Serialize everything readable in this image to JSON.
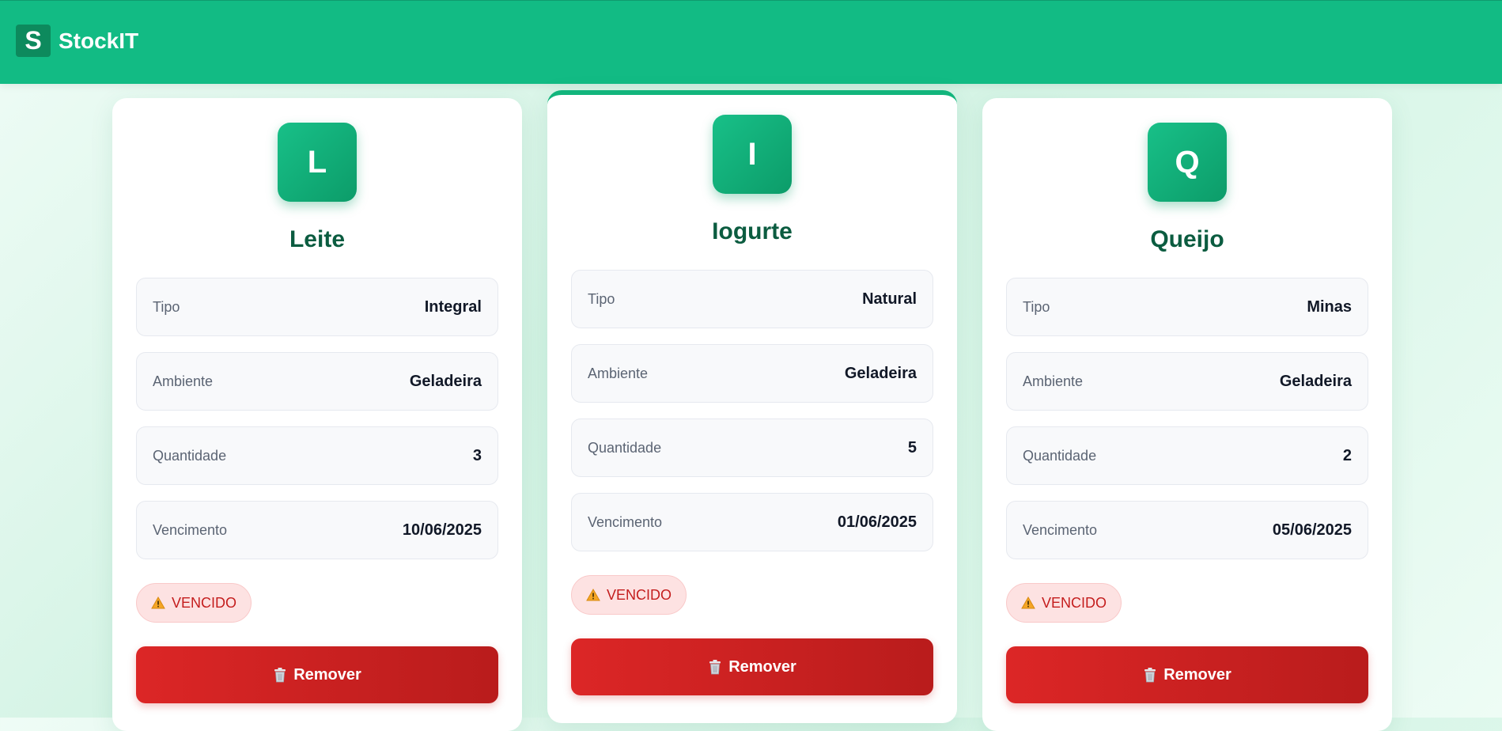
{
  "app": {
    "logo_letter": "S",
    "name": "StockIT"
  },
  "colors": {
    "brand": "#12bb84",
    "danger": "#dc2626",
    "badge_bg": "#fde2e2"
  },
  "labels": {
    "tipo": "Tipo",
    "ambiente": "Ambiente",
    "quantidade": "Quantidade",
    "vencimento": "Vencimento",
    "status": "VENCIDO",
    "remove": "Remover"
  },
  "products": [
    {
      "initial": "L",
      "name": "Leite",
      "tipo": "Integral",
      "ambiente": "Geladeira",
      "quantidade": "3",
      "vencimento": "10/06/2025"
    },
    {
      "initial": "I",
      "name": "Iogurte",
      "tipo": "Natural",
      "ambiente": "Geladeira",
      "quantidade": "5",
      "vencimento": "01/06/2025"
    },
    {
      "initial": "Q",
      "name": "Queijo",
      "tipo": "Minas",
      "ambiente": "Geladeira",
      "quantidade": "2",
      "vencimento": "05/06/2025"
    }
  ]
}
